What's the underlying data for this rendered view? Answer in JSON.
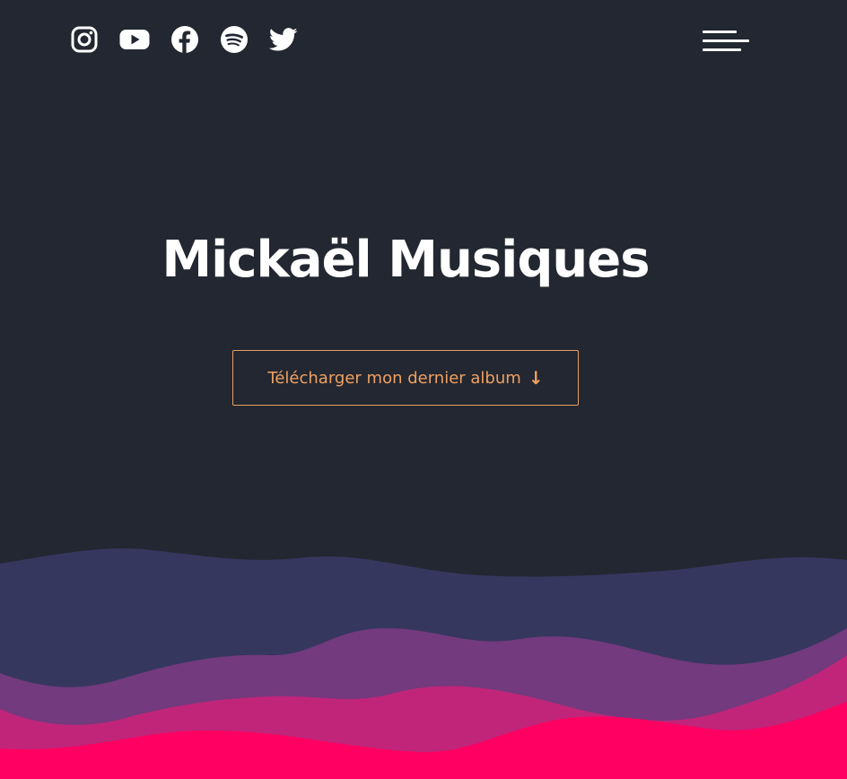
{
  "header": {
    "socials": [
      {
        "name": "instagram",
        "icon": "instagram-icon"
      },
      {
        "name": "youtube",
        "icon": "youtube-icon"
      },
      {
        "name": "facebook",
        "icon": "facebook-icon"
      },
      {
        "name": "spotify",
        "icon": "spotify-icon"
      },
      {
        "name": "twitter",
        "icon": "twitter-icon"
      }
    ],
    "menu_icon": "hamburger-menu-icon"
  },
  "hero": {
    "title": "Mickaël Musiques",
    "cta_label": "Télécharger mon dernier album",
    "cta_icon": "arrow-down-icon",
    "cta_arrow": "↓"
  },
  "colors": {
    "background": "#222731",
    "accent": "#f0a060",
    "wave_1": "#35375e",
    "wave_2": "#733a7d",
    "wave_3": "#c0257a",
    "wave_4": "#ff0062"
  }
}
